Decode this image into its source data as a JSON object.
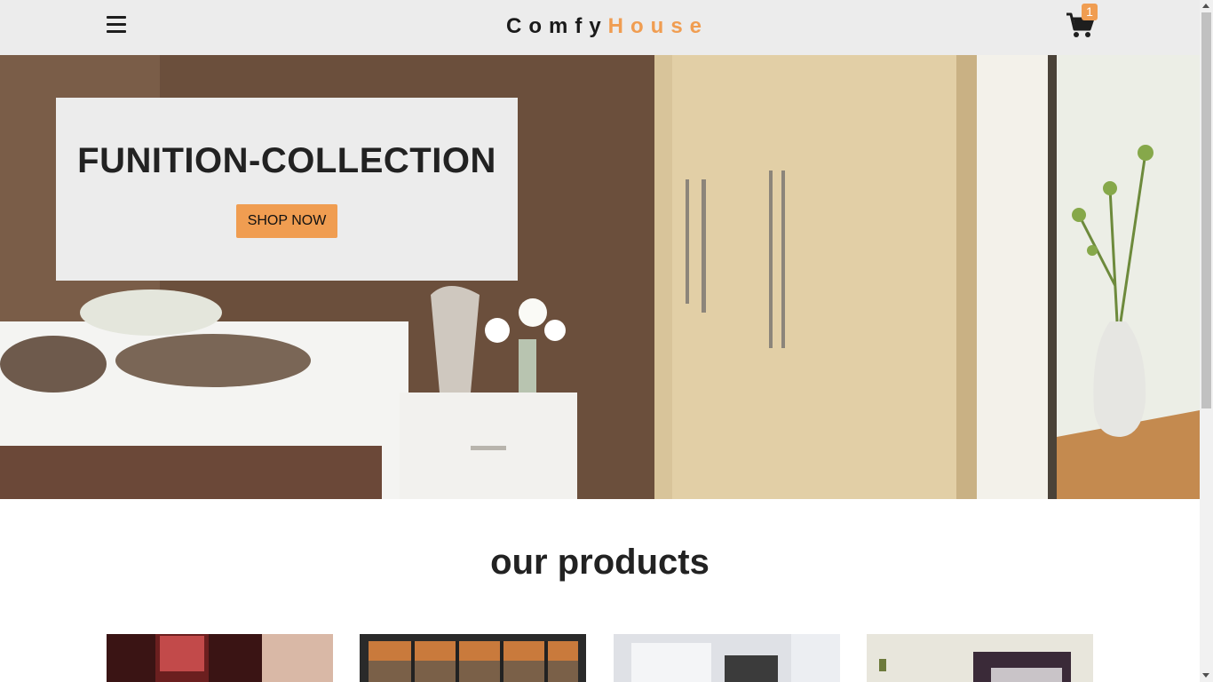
{
  "navbar": {
    "brand_part1": "Comfy",
    "brand_part2": "House",
    "menu_icon": "hamburger-menu-icon",
    "cart_icon": "shopping-cart-icon",
    "cart_count": "1",
    "accent_color": "#f09d51"
  },
  "hero": {
    "title": "FUNITION-COLLECTION",
    "button_label": "SHOP NOW"
  },
  "products": {
    "section_title": "our products",
    "items": [
      {
        "image": "bedroom-red-wall-photo"
      },
      {
        "image": "window-mountain-view-photo"
      },
      {
        "image": "white-bedroom-photo"
      },
      {
        "image": "bed-dark-headboard-photo"
      }
    ]
  }
}
